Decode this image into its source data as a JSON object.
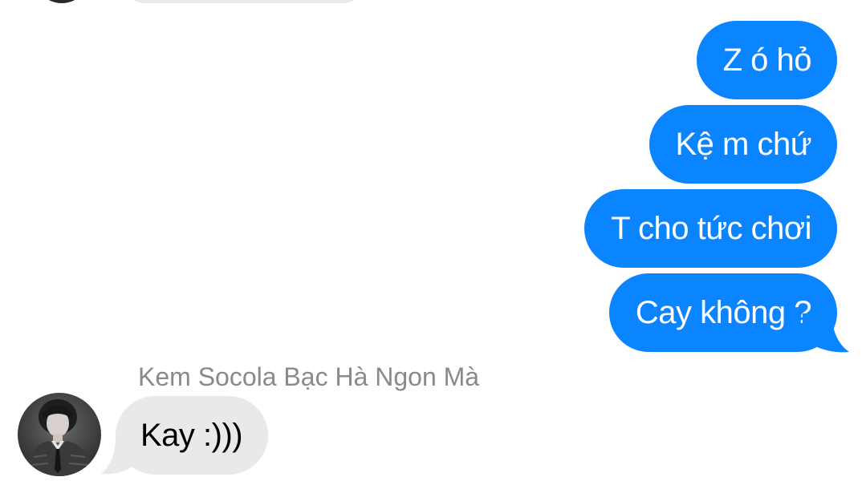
{
  "conversation": {
    "outgoing_messages": [
      {
        "text": "Z ó hỏ"
      },
      {
        "text": "Kệ m chứ"
      },
      {
        "text": "T cho tức chơi"
      },
      {
        "text": "Cay không ?"
      }
    ],
    "incoming": {
      "sender_name": "Kem Socola Bạc Hà Ngon Mà",
      "messages": [
        {
          "text": "Kay :)))"
        }
      ],
      "avatar_icon": "user-avatar-photo"
    }
  },
  "colors": {
    "sent_bubble": "#0a84ff",
    "received_bubble": "#e9e9eb",
    "sender_name": "#8a8a8e",
    "background": "#ffffff"
  }
}
